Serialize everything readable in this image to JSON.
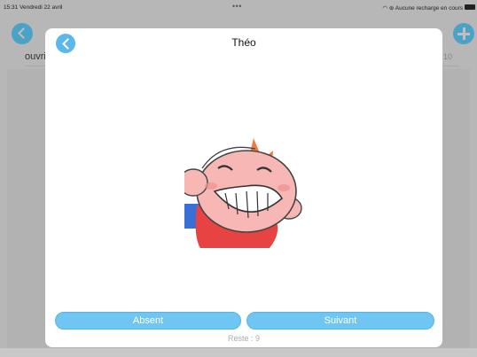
{
  "status_bar": {
    "time_date": "15:31  Vendredi 22 avril",
    "dots": "•••",
    "right_status": "Aucune recharge en cours"
  },
  "background": {
    "list_label": "ouvri",
    "count": "10"
  },
  "modal": {
    "title": "Théo",
    "absent_label": "Absent",
    "next_label": "Suivant",
    "remaining": "Reste : 9"
  },
  "colors": {
    "accent": "#5ab8ec",
    "button": "#6fc6f2",
    "overlay": "#b7b7b7"
  }
}
